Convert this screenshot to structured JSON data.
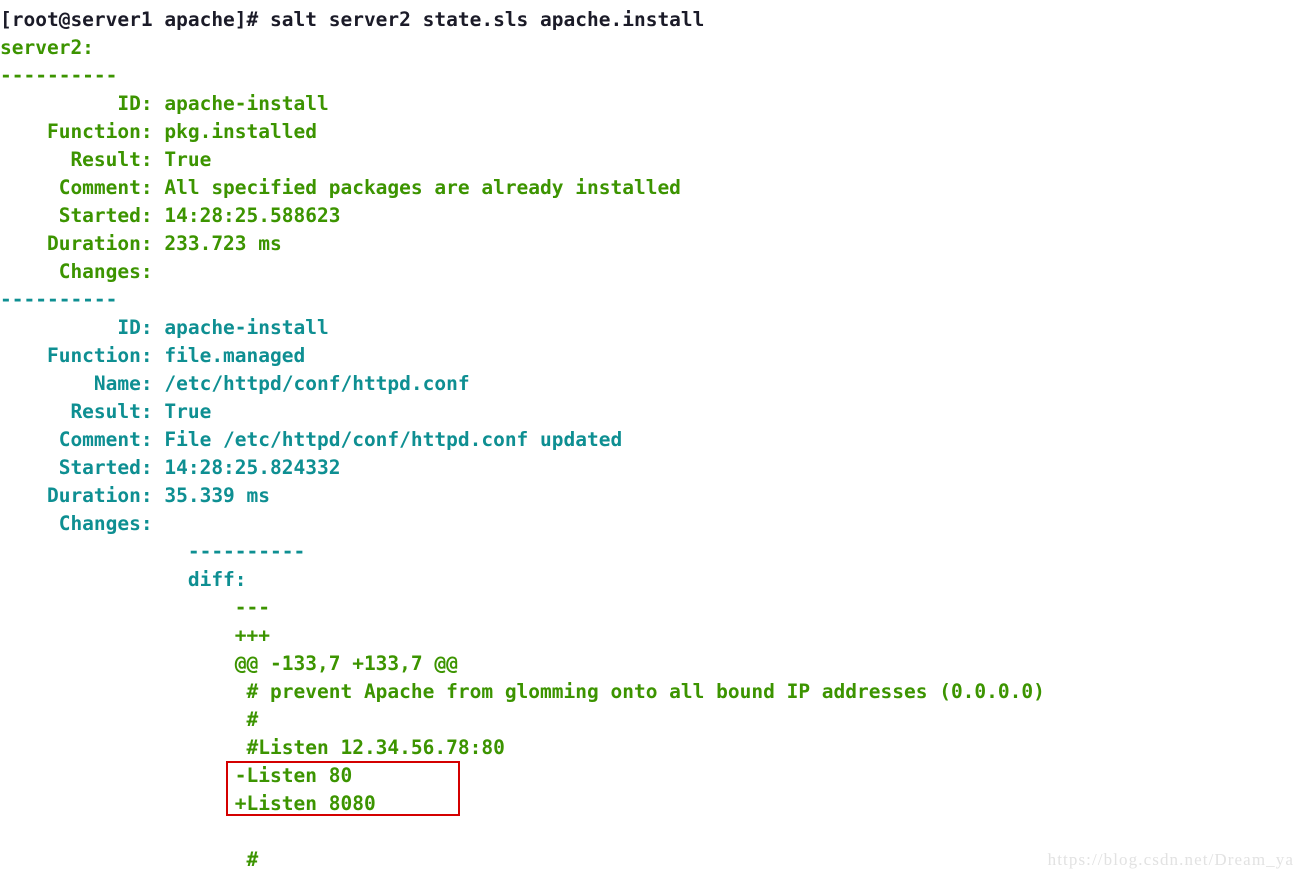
{
  "terminal": {
    "background_color": "#ffffff",
    "prompt_color": "#1b1b28",
    "green_color": "#3c9400",
    "teal_color": "#0e8f92",
    "highlight_box_color": "#d40000",
    "command_line": "[root@server1 apache]# salt server2 state.sls apache.install",
    "minion_id": "server2:",
    "separator_top": "----------",
    "separator_mid": "----------",
    "separator_inner": "          ----------",
    "blank": "",
    "states": [
      {
        "name": "pkg-install-state",
        "color": "green",
        "rows": [
          "          ID: apache-install",
          "    Function: pkg.installed",
          "      Result: True",
          "     Comment: All specified packages are already installed",
          "     Started: 14:28:25.588623",
          "    Duration: 233.723 ms",
          "     Changes:   "
        ]
      },
      {
        "name": "file-managed-state",
        "color": "teal",
        "rows": [
          "          ID: apache-install",
          "    Function: file.managed",
          "        Name: /etc/httpd/conf/httpd.conf",
          "      Result: True",
          "     Comment: File /etc/httpd/conf/httpd.conf updated",
          "     Started: 14:28:25.824332",
          "    Duration: 35.339 ms",
          "     Changes:   "
        ]
      }
    ],
    "diff_block": {
      "separator": "                ----------",
      "key": "                diff:",
      "lines": [
        "                    ---",
        "                    +++",
        "                    @@ -133,7 +133,7 @@",
        "                     # prevent Apache from glomming onto all bound IP addresses (0.0.0.0)",
        "                     #",
        "                     #Listen 12.34.56.78:80",
        "                    -Listen 80",
        "                    +Listen 8080",
        "",
        "                     #"
      ],
      "removed_line": "                    -Listen 80",
      "added_line": "                    +Listen 8080"
    },
    "watermark": "https://blog.csdn.net/Dream_ya"
  }
}
